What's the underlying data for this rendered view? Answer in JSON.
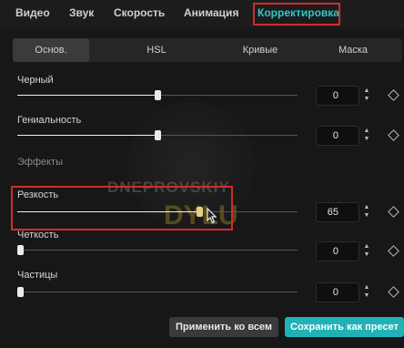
{
  "tabs": [
    {
      "label": "Видео"
    },
    {
      "label": "Звук"
    },
    {
      "label": "Скорость"
    },
    {
      "label": "Анимация"
    },
    {
      "label": "Корректировка",
      "active": true
    }
  ],
  "subtabs": [
    {
      "label": "Основ.",
      "active": true
    },
    {
      "label": "HSL"
    },
    {
      "label": "Кривые"
    },
    {
      "label": "Маска"
    }
  ],
  "controls": {
    "black": {
      "label": "Черный",
      "value": "0",
      "level": 0.5
    },
    "brilliance": {
      "label": "Гениальность",
      "value": "0",
      "level": 0.5
    },
    "effects_heading": "Эффекты",
    "sharpness": {
      "label": "Резкость",
      "value": "65",
      "level": 0.65
    },
    "clarity": {
      "label": "Четкость",
      "value": "0",
      "level": 0
    },
    "particles": {
      "label": "Частицы",
      "value": "0",
      "level": 0
    }
  },
  "watermark": {
    "line1": "DNEPROVSKIY",
    "line2": "DYLU"
  },
  "buttons": {
    "apply_all": "Применить ко всем",
    "save_preset": "Сохранить как пресет"
  },
  "colors": {
    "accent": "#20b2b6",
    "active_tab": "#2fc8c8",
    "highlight": "#d42a2a"
  }
}
